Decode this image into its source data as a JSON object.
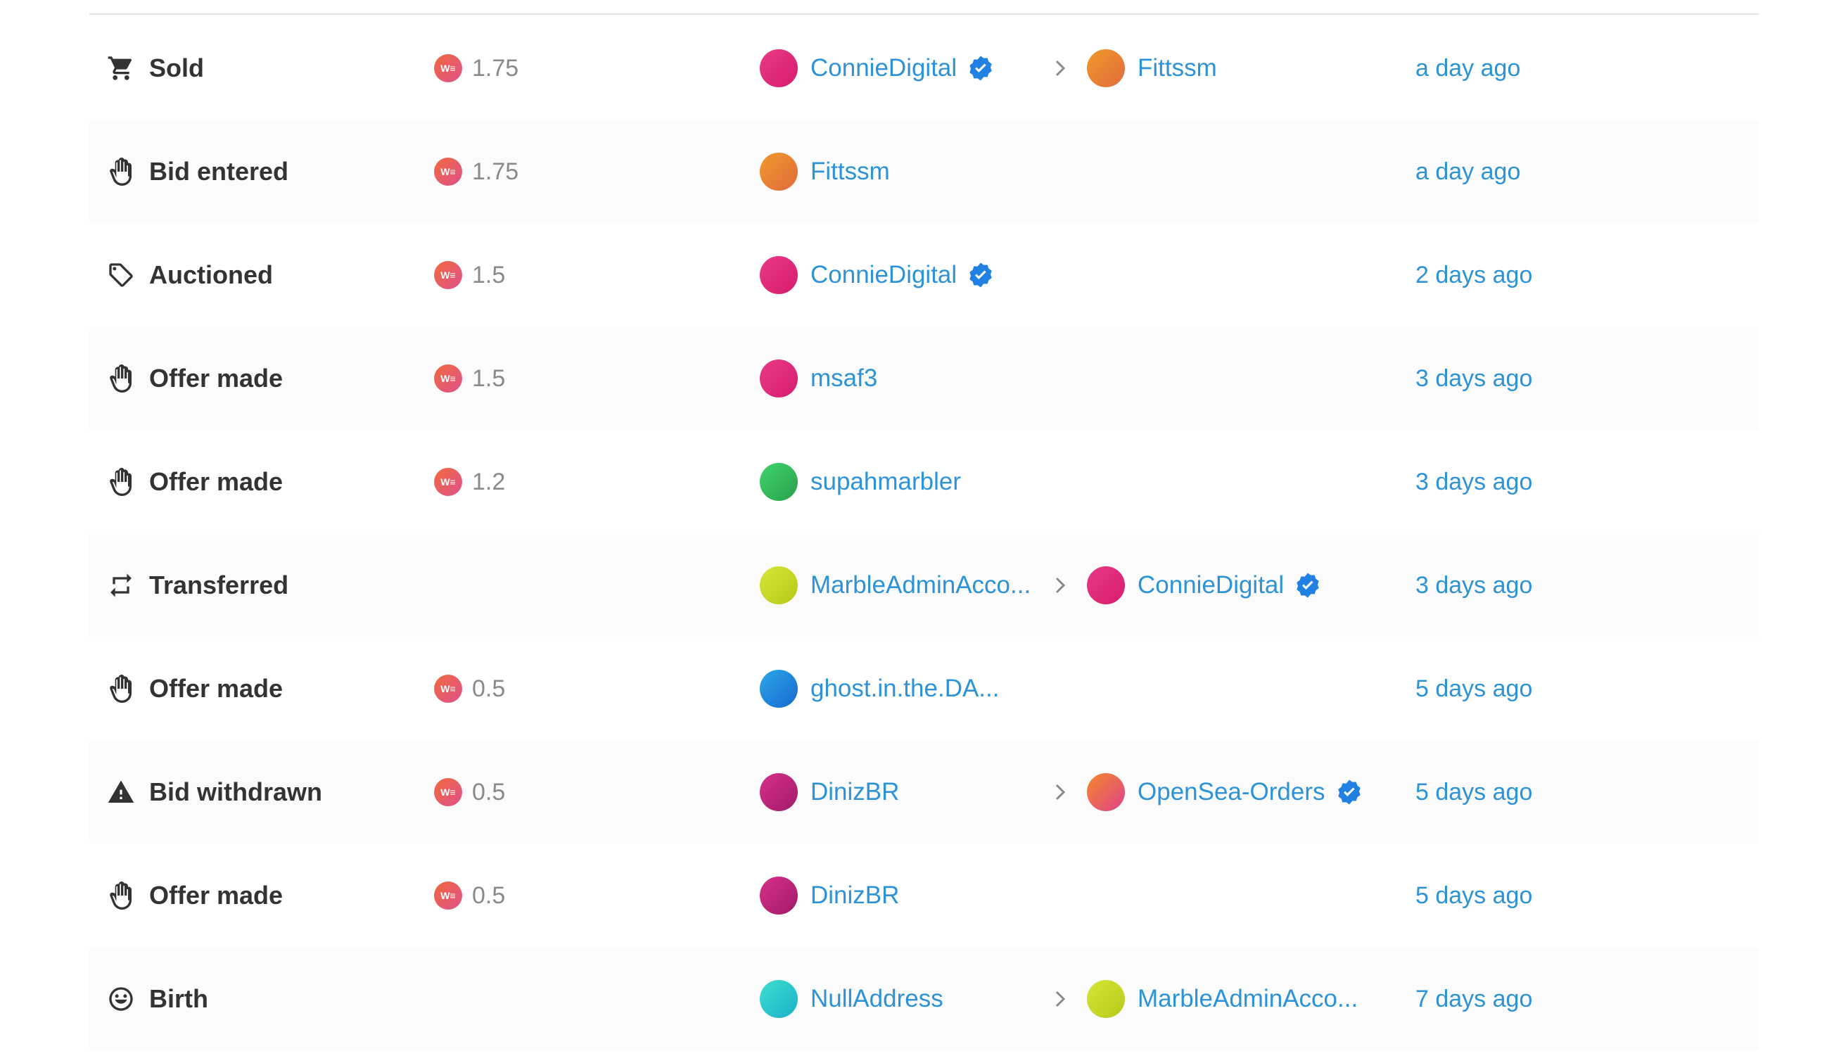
{
  "colors": {
    "link": "#2d93d8",
    "verified_badge": "#2081e2",
    "label": "#333333",
    "price": "#8a8a8a"
  },
  "price_token": {
    "icon": "weth-token-icon",
    "text": "W≡"
  },
  "rows": [
    {
      "event": "Sold",
      "icon": "cart-icon",
      "price": "1.75",
      "from": {
        "name": "ConnieDigital",
        "verified": true,
        "avatar": "pink"
      },
      "to": {
        "name": "Fittssm",
        "verified": false,
        "avatar": "orange"
      },
      "time": "a day ago"
    },
    {
      "event": "Bid entered",
      "icon": "hand-icon",
      "price": "1.75",
      "from": {
        "name": "Fittssm",
        "verified": false,
        "avatar": "orange"
      },
      "to": null,
      "time": "a day ago"
    },
    {
      "event": "Auctioned",
      "icon": "tag-icon",
      "price": "1.5",
      "from": {
        "name": "ConnieDigital",
        "verified": true,
        "avatar": "pink"
      },
      "to": null,
      "time": "2 days ago"
    },
    {
      "event": "Offer made",
      "icon": "hand-icon",
      "price": "1.5",
      "from": {
        "name": "msaf3",
        "verified": false,
        "avatar": "pink"
      },
      "to": null,
      "time": "3 days ago"
    },
    {
      "event": "Offer made",
      "icon": "hand-icon",
      "price": "1.2",
      "from": {
        "name": "supahmarbler",
        "verified": false,
        "avatar": "green"
      },
      "to": null,
      "time": "3 days ago"
    },
    {
      "event": "Transferred",
      "icon": "transfer-icon",
      "price": "",
      "from": {
        "name": "MarbleAdminAcco...",
        "verified": false,
        "avatar": "lime"
      },
      "to": {
        "name": "ConnieDigital",
        "verified": true,
        "avatar": "pink"
      },
      "time": "3 days ago"
    },
    {
      "event": "Offer made",
      "icon": "hand-icon",
      "price": "0.5",
      "from": {
        "name": "ghost.in.the.DA...",
        "verified": false,
        "avatar": "blue"
      },
      "to": null,
      "time": "5 days ago"
    },
    {
      "event": "Bid withdrawn",
      "icon": "warning-icon",
      "price": "0.5",
      "from": {
        "name": "DinizBR",
        "verified": false,
        "avatar": "magenta"
      },
      "to": {
        "name": "OpenSea-Orders",
        "verified": true,
        "avatar": "orange-pink"
      },
      "time": "5 days ago"
    },
    {
      "event": "Offer made",
      "icon": "hand-icon",
      "price": "0.5",
      "from": {
        "name": "DinizBR",
        "verified": false,
        "avatar": "magenta"
      },
      "to": null,
      "time": "5 days ago"
    },
    {
      "event": "Birth",
      "icon": "smile-icon",
      "price": "",
      "from": {
        "name": "NullAddress",
        "verified": false,
        "avatar": "teal"
      },
      "to": {
        "name": "MarbleAdminAcco...",
        "verified": false,
        "avatar": "lime"
      },
      "time": "7 days ago"
    }
  ]
}
